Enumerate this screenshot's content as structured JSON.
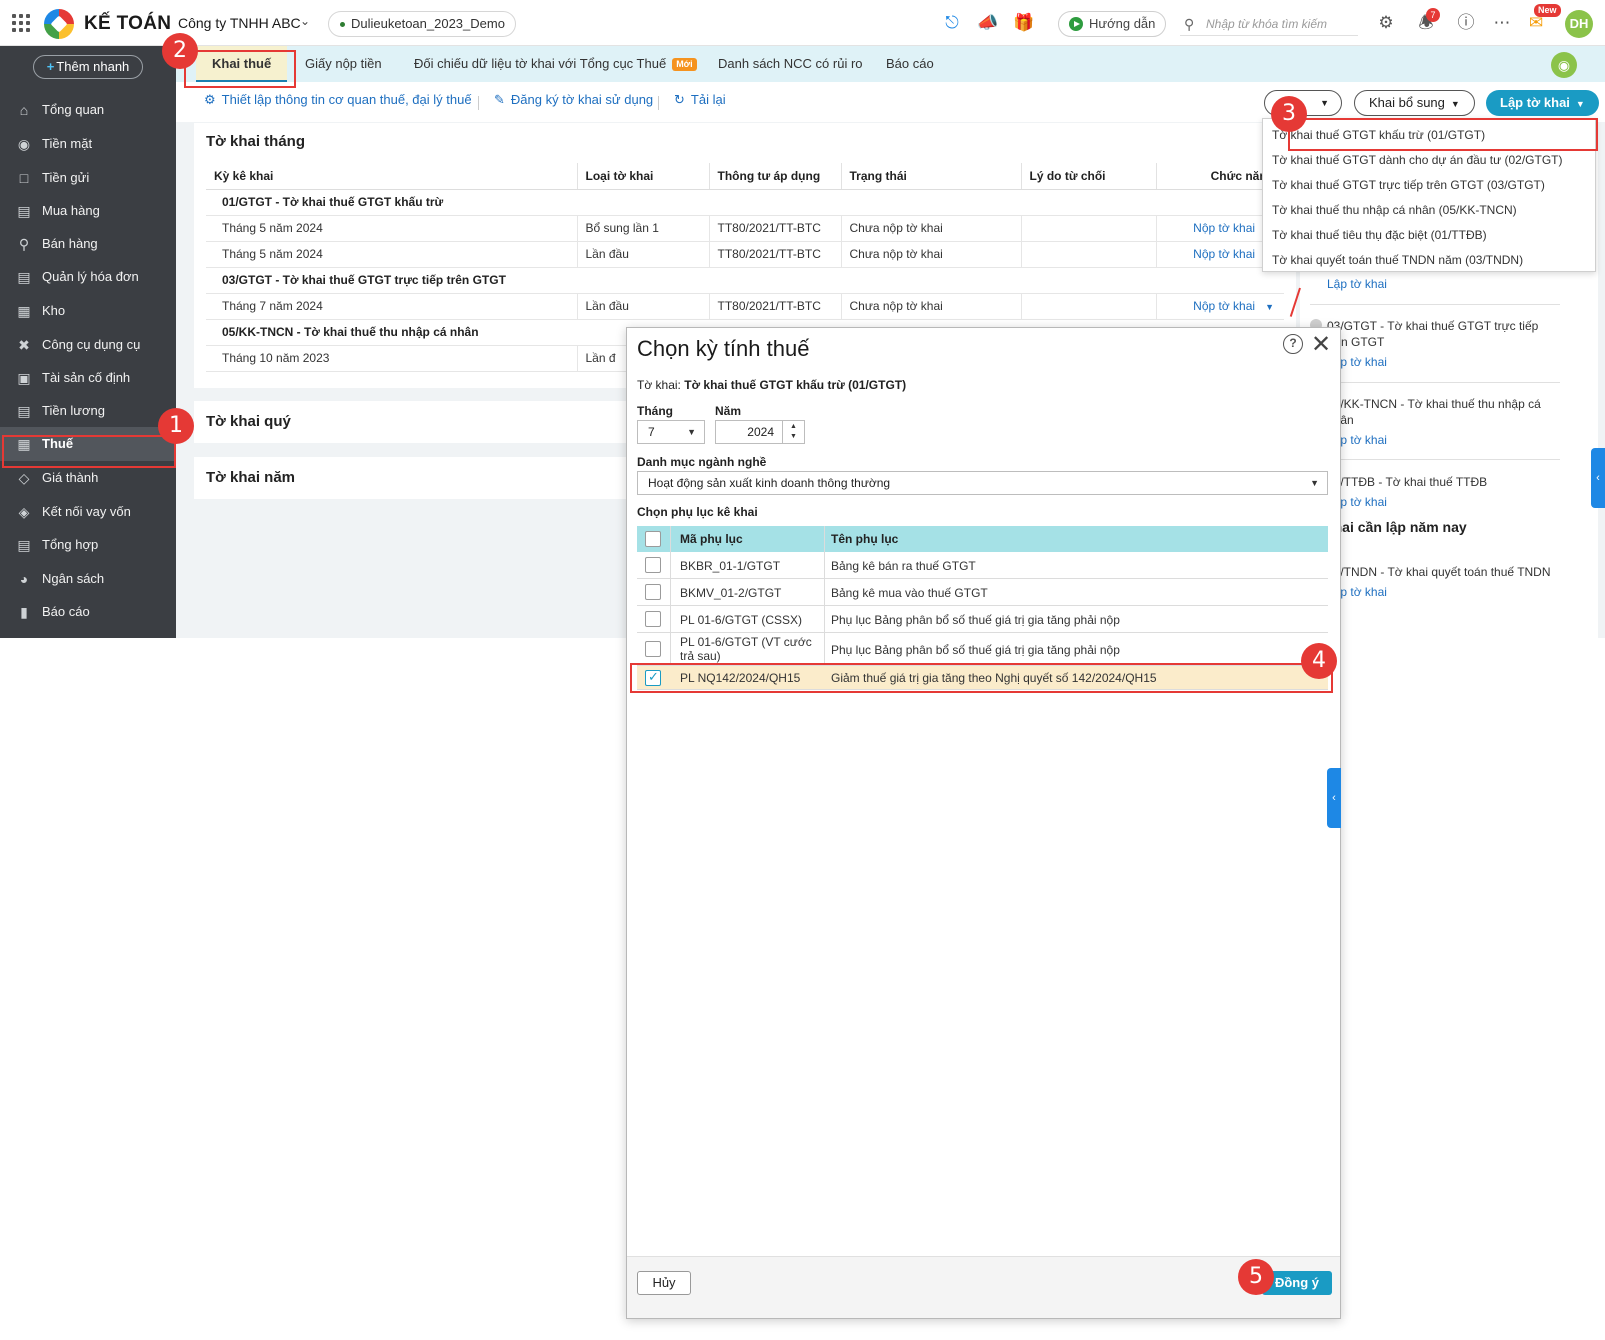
{
  "header": {
    "logo_text": "KẾ TOÁN",
    "company": "Công ty TNHH ABC",
    "database": "Dulieuketoan_2023_Demo",
    "guide_label": "Hướng dẫn",
    "search_placeholder": "Nhập từ khóa tìm kiếm",
    "notification_count": "7",
    "new_badge": "New",
    "avatar_initials": "DH"
  },
  "sidebar": {
    "quick_add": "Thêm nhanh",
    "items": [
      {
        "label": "Tổng quan",
        "icon": "home-icon"
      },
      {
        "label": "Tiền mặt",
        "icon": "money-bag-icon"
      },
      {
        "label": "Tiền gửi",
        "icon": "bank-icon"
      },
      {
        "label": "Mua hàng",
        "icon": "shopping-bag-icon"
      },
      {
        "label": "Bán hàng",
        "icon": "cart-icon"
      },
      {
        "label": "Quản lý hóa đơn",
        "icon": "invoice-icon"
      },
      {
        "label": "Kho",
        "icon": "warehouse-icon"
      },
      {
        "label": "Công cụ dụng cụ",
        "icon": "tools-icon"
      },
      {
        "label": "Tài sản cố định",
        "icon": "car-icon"
      },
      {
        "label": "Tiền lương",
        "icon": "payroll-icon"
      },
      {
        "label": "Thuế",
        "icon": "tax-building-icon"
      },
      {
        "label": "Giá thành",
        "icon": "price-tag-icon"
      },
      {
        "label": "Kết nối vay vốn",
        "icon": "loan-icon"
      },
      {
        "label": "Tổng hợp",
        "icon": "summary-icon"
      },
      {
        "label": "Ngân sách",
        "icon": "budget-icon"
      },
      {
        "label": "Báo cáo",
        "icon": "report-chart-icon"
      }
    ]
  },
  "tabs": {
    "t1": "Khai thuế",
    "t2": "Giấy nộp tiền",
    "t3": "Đối chiếu dữ liệu tờ khai với Tổng cục Thuế",
    "t3_badge": "Mới",
    "t4": "Danh sách NCC có rủi ro",
    "t5": "Báo cáo"
  },
  "toolbar": {
    "setup": "Thiết lập thông tin cơ quan thuế, đại lý thuế",
    "register": "Đăng ký tờ khai sử dụng",
    "reload": "Tải lại",
    "supplement": "Khai bổ sung",
    "create": "Lập tờ khai"
  },
  "monthly": {
    "title": "Tờ khai tháng",
    "columns": [
      "Kỳ kê khai",
      "Loại tờ khai",
      "Thông tư áp dụng",
      "Trạng thái",
      "Lý do từ chối",
      "Chức năng"
    ],
    "group1": "01/GTGT - Tờ khai thuế GTGT khấu trừ",
    "group2": "03/GTGT - Tờ khai thuế GTGT trực tiếp trên GTGT",
    "group3": "05/KK-TNCN - Tờ khai thuế thu nhập cá nhân",
    "rows": [
      {
        "period": "Tháng 5 năm 2024",
        "type": "Bổ sung lần 1",
        "circular": "TT80/2021/TT-BTC",
        "status": "Chưa nộp tờ khai",
        "action": "Nộp tờ khai"
      },
      {
        "period": "Tháng 5 năm 2024",
        "type": "Lần đầu",
        "circular": "TT80/2021/TT-BTC",
        "status": "Chưa nộp tờ khai",
        "action": "Nộp tờ khai"
      },
      {
        "period": "Tháng 7 năm 2024",
        "type": "Lần đầu",
        "circular": "TT80/2021/TT-BTC",
        "status": "Chưa nộp tờ khai",
        "action": "Nộp tờ khai"
      },
      {
        "period": "Tháng 10 năm 2023",
        "type": "Lần đ"
      }
    ]
  },
  "quarterly": {
    "title": "Tờ khai quý"
  },
  "yearly": {
    "title": "Tờ khai năm"
  },
  "right_panel": {
    "items": [
      {
        "text": "Lập tờ khai"
      },
      {
        "text": "03/GTGT - Tờ khai thuế GTGT trực tiếp trên GTGT",
        "link": "Lập tờ khai"
      },
      {
        "text": "05/KK-TNCN - Tờ khai thuế thu nhập cá nhân",
        "link": "Lập tờ khai"
      },
      {
        "text": "01/TTĐB - Tờ khai thuế TTĐB",
        "link": "Lập tờ khai"
      }
    ],
    "heading": "ờ khai cần lập năm nay",
    "yearly_item": {
      "text": "03/TNDN - Tờ khai quyết toán thuế TNDN",
      "link": "Lập tờ khai"
    }
  },
  "dropdown": {
    "items": [
      "Tờ khai thuế GTGT khấu trừ (01/GTGT)",
      "Tờ khai thuế GTGT dành cho dự án đầu tư (02/GTGT)",
      "Tờ khai thuế GTGT trực tiếp trên GTGT (03/GTGT)",
      "Tờ khai thuế thu nhập cá nhân (05/KK-TNCN)",
      "Tờ khai thuế tiêu thụ đặc biệt (01/TTĐB)",
      "Tờ khai quyết toán thuế TNDN năm (03/TNDN)"
    ]
  },
  "dialog": {
    "title": "Chọn kỳ tính thuế",
    "form_label": "Tờ khai:",
    "form_value": "Tờ khai thuế GTGT khấu trừ (01/GTGT)",
    "month_label": "Tháng",
    "month_value": "7",
    "year_label": "Năm",
    "year_value": "2024",
    "industry_label": "Danh mục ngành nghề",
    "industry_value": "Hoạt động sản xuất kinh doanh thông thường",
    "appendix_label": "Chọn phụ lục kê khai",
    "col_code": "Mã phụ lục",
    "col_name": "Tên phụ lục",
    "rows": [
      {
        "code": "BKBR_01-1/GTGT",
        "name": "Bảng kê bán ra thuế GTGT",
        "checked": false
      },
      {
        "code": "BKMV_01-2/GTGT",
        "name": "Bảng kê mua vào thuế GTGT",
        "checked": false
      },
      {
        "code": "PL 01-6/GTGT (CSSX)",
        "name": "Phụ lục Bảng phân bổ số thuế giá trị gia tăng phải nộp",
        "checked": false
      },
      {
        "code": "PL 01-6/GTGT (VT cước trả sau)",
        "name": "Phụ lục Bảng phân bổ số thuế giá trị gia tăng phải nộp",
        "checked": false
      },
      {
        "code": "PL NQ142/2024/QH15",
        "name": "Giảm thuế giá trị gia tăng theo Nghị quyết số 142/2024/QH15",
        "checked": true
      }
    ],
    "cancel": "Hủy",
    "ok": "Đồng ý"
  },
  "annotations": {
    "step1": "1",
    "step2": "2",
    "step3": "3",
    "step4": "4",
    "step5": "5"
  },
  "colors": {
    "accent": "#1a9bc4",
    "highlight": "#e53935",
    "sidebar": "#3b3e43",
    "tabbar": "#dff2f7",
    "selected_row": "#fbeccb"
  }
}
